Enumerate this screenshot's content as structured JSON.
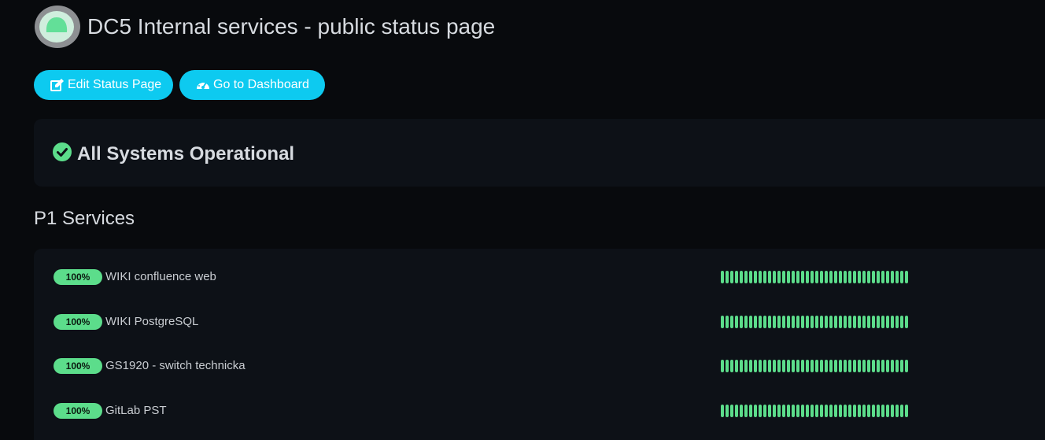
{
  "header": {
    "title": "DC5 Internal services - public status page",
    "logo_icon": "uptime-kuma-logo"
  },
  "actions": {
    "edit_label": "Edit Status Page",
    "edit_icon": "edit-icon",
    "dashboard_label": "Go to Dashboard",
    "dashboard_icon": "tachometer-icon"
  },
  "overall": {
    "status_text": "All Systems Operational",
    "icon": "check-circle-icon",
    "color": "#5cdd8b"
  },
  "groups": [
    {
      "name": "P1 Services",
      "monitors": [
        {
          "uptime": "100%",
          "name": "WIKI confluence web",
          "beats_up": 40
        },
        {
          "uptime": "100%",
          "name": "WIKI PostgreSQL",
          "beats_up": 40
        },
        {
          "uptime": "100%",
          "name": "GS1920 - switch technicka",
          "beats_up": 40
        },
        {
          "uptime": "100%",
          "name": "GitLab PST",
          "beats_up": 40
        }
      ]
    }
  ],
  "colors": {
    "accent": "#0dcaf0",
    "up": "#5cdd8b",
    "background": "#080a0d",
    "panel": "#0d1117"
  }
}
